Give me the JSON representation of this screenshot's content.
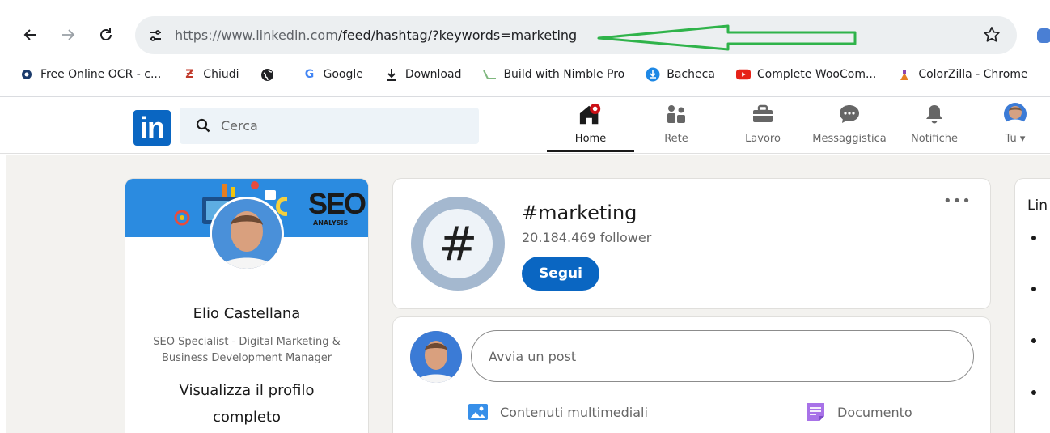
{
  "browser": {
    "url_prefix": "https://www.linkedin.com",
    "url_path": "/feed/hashtag/?keywords=marketing",
    "bookmarks": [
      {
        "label": "Free Online OCR - c...",
        "icon": "ocr-icon",
        "color": "#1a3a6b"
      },
      {
        "label": "Chiudi",
        "icon": "chiudi-icon",
        "color": "#c0392b"
      },
      {
        "label": "",
        "icon": "globe-icon",
        "color": "#202124"
      },
      {
        "label": "Google",
        "icon": "google-icon",
        "color": "#4285f4"
      },
      {
        "label": "Download",
        "icon": "download-icon",
        "color": "#202124"
      },
      {
        "label": "Build with Nimble Pro",
        "icon": "nimble-icon",
        "color": "#7fb77e"
      },
      {
        "label": "Bacheca",
        "icon": "bacheca-icon",
        "color": "#1e88e5"
      },
      {
        "label": "Complete WooCom...",
        "icon": "youtube-icon",
        "color": "#e62117"
      },
      {
        "label": "ColorZilla - Chrome",
        "icon": "colorzilla-icon",
        "color": "#e67e22"
      }
    ]
  },
  "linkedin": {
    "logo": "in",
    "search_placeholder": "Cerca",
    "nav": [
      {
        "label": "Home",
        "icon": "home-icon"
      },
      {
        "label": "Rete",
        "icon": "network-icon"
      },
      {
        "label": "Lavoro",
        "icon": "briefcase-icon"
      },
      {
        "label": "Messaggistica",
        "icon": "messaging-icon"
      },
      {
        "label": "Notifiche",
        "icon": "bell-icon"
      },
      {
        "label": "Tu",
        "icon": "avatar"
      }
    ],
    "accent": "#0a66c2"
  },
  "profile": {
    "cover_title": "SEO",
    "cover_subtitle": "ANALYSIS",
    "name": "Elio Castellana",
    "headline": "SEO Specialist - Digital Marketing & Business Development Manager",
    "view_profile": "Visualizza il profilo completo"
  },
  "hashtag": {
    "symbol": "#",
    "title": "#marketing",
    "followers": "20.184.469 follower",
    "follow_label": "Segui",
    "more": "•••"
  },
  "composer": {
    "placeholder": "Avvia un post",
    "actions": [
      {
        "label": "Contenuti multimediali",
        "icon": "image-icon"
      },
      {
        "label": "Documento",
        "icon": "document-icon"
      }
    ]
  },
  "right_panel": {
    "title": "Lin"
  }
}
